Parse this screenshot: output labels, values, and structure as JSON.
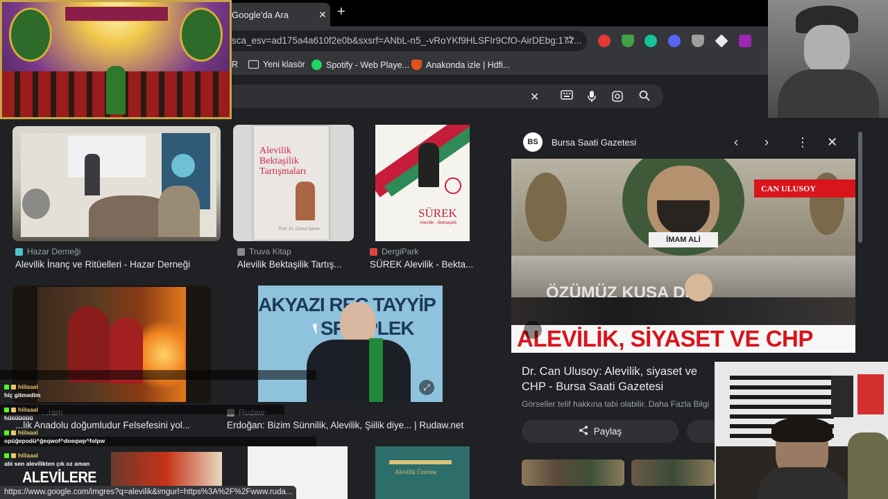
{
  "browser": {
    "tab_title": "Google'da Ara",
    "tab_close": "✕",
    "new_tab": "+",
    "url": "sca_esv=ad175a4a610f2e0b&sxsrf=ANbL-n5_-vRoYKf9HLSFIr9CfO-AirDEbg:177...",
    "bookmarks": [
      "R",
      "Yeni klasör",
      "Spotify - Web Playe...",
      "Anakonda izle | Hdfi..."
    ],
    "status_url": "https://www.google.com/imgres?q=alevilik&imgurl=https%3A%2F%2Fwww.ruda..."
  },
  "search": {
    "clear": "✕"
  },
  "results": [
    {
      "source": "Hazar Derneği",
      "caption": "Alevilik İnanç ve Ritüelleri - Hazar Derneği",
      "favicon_color": "#4fc3c9"
    },
    {
      "source": "Truva Kitap",
      "caption": "Alevilik Bektaşilik Tartış...",
      "favicon_color": "#8a8a8a"
    },
    {
      "source": "DergiPark",
      "caption": "SÜREK Alevilik - Bekta...",
      "favicon_color": "#d44"
    },
    {
      "source": "...ram",
      "caption": "...lik Anadolu doğumludur Felsefesini yol...",
      "favicon_color": "#888"
    },
    {
      "source": "Rudaw",
      "caption": "Erdoğan: Bizim Sünnilik, Alevilik, Şiilik diye... | Rudaw.net",
      "favicon_color": "#888"
    }
  ],
  "thumb_text": {
    "book1": [
      "Alevilik",
      "Bektaşilik",
      "Tartışmaları",
      "Prof. Dr. Cemal Şener"
    ],
    "book2": [
      "SÜREK",
      "Alevilik - Bektaşilik"
    ],
    "erdogan_banner": "AKYAZI REC  TAYYİP",
    "erdogan_banner2": "SP  MPLEK",
    "book3": "Alevilik Üzerine"
  },
  "panel": {
    "logo": "BS",
    "source": "Bursa Saati Gazetesi",
    "img_name_tag": "CAN ULUSOY",
    "img_label": "İMAM ALİ",
    "img_banner_mid": "ÖZÜMÜZ    KUSA  DIR",
    "img_headline": "ALEVİLİK, SİYASET VE CHP",
    "title": "Dr. Can Ulusoy: Alevilik, siyaset ve CHP - Bursa Saati Gazetesi",
    "copyright_note": "Görseller telif hakkına tabi olabilir. Daha Fazla Bilgi",
    "share": "Paylaş"
  },
  "chat": [
    {
      "user": "hiilaaal",
      "msg": ""
    },
    {
      "user": "hiilaaal",
      "msg": "hiç gitmedim"
    },
    {
      "user": "hiilaaal",
      "msg": "hüüüüüüü"
    },
    {
      "user": "hiilaaal",
      "msg": "opüğepodü^ğeqwof^doeqwp^folpw"
    },
    {
      "user": "hiilaaal",
      "msg": "abi sen alevilikten çık oz aman"
    }
  ],
  "overlay_text": "ALEVİLERE"
}
